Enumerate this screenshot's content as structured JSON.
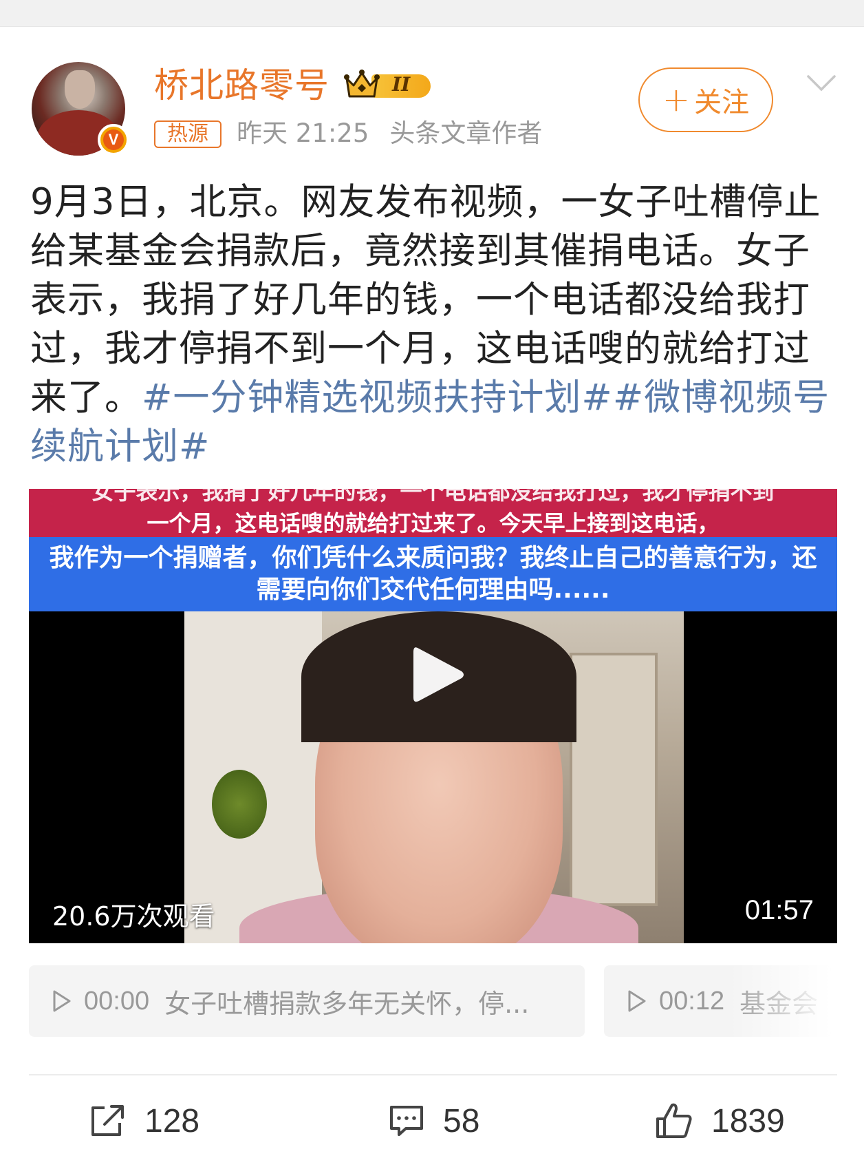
{
  "author": {
    "name": "桥北路零号",
    "vip_level": "II",
    "verified": true,
    "tag": "热源",
    "time": "昨天 21:25",
    "role": "头条文章作者"
  },
  "follow_button": {
    "label": "关注",
    "icon": "plus-icon"
  },
  "more_icon": "chevron-down-icon",
  "post": {
    "text": "9月3日，北京。网友发布视频，一女子吐槽停止给某基金会捐款后，竟然接到其催捐电话。女子表示，我捐了好几年的钱，一个电话都没给我打过，我才停捐不到一个月，这电话嗖的就给打过来了。",
    "topics": "#一分钟精选视频扶持计划##微博视频号续航计划#"
  },
  "video": {
    "caption_red_line1": "女子表示，我捐了好几年的钱，一个电话都没给我打过，我才停捐不到",
    "caption_red_line2": "一个月，这电话嗖的就给打过来了。今天早上接到这电话，",
    "caption_blue_line1": "我作为一个捐赠者，你们凭什么来质问我？我终止自己的善意行为，还",
    "caption_blue_line2": "需要向你们交代任何理由吗......",
    "views": "20.6万次观看",
    "duration": "01:57"
  },
  "chapters": [
    {
      "time": "00:00",
      "title": "女子吐槽捐款多年无关怀，停..."
    },
    {
      "time": "00:12",
      "title": "基金会"
    }
  ],
  "actions": {
    "share_count": "128",
    "comment_count": "58",
    "like_count": "1839"
  },
  "colors": {
    "accent_orange": "#e8762a",
    "topic_blue": "#5a7baa",
    "caption_red": "#c5234a",
    "caption_blue": "#2f6ee6"
  }
}
